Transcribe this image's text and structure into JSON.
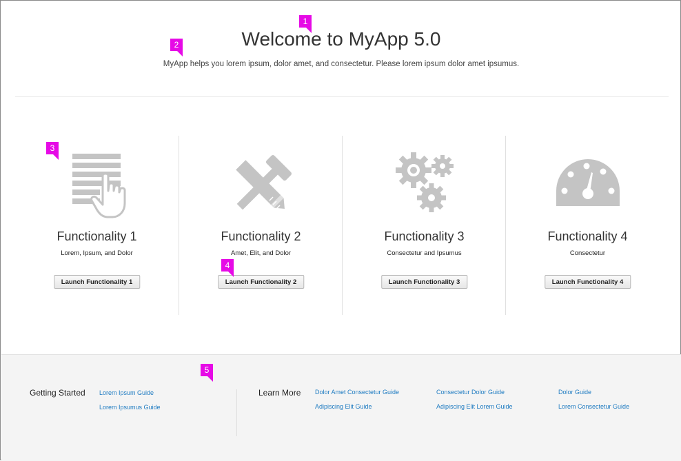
{
  "header": {
    "title_prefix": "Welcome to ",
    "title_app": "MyApp 5.0",
    "subtitle": "MyApp helps you lorem ipsum, dolor amet, and consectetur. Please lorem ipsum dolor amet ipsumus."
  },
  "features": [
    {
      "title": "Functionality 1",
      "desc": "Lorem, Ipsum, and Dolor",
      "button": "Launch Functionality 1",
      "icon": "list-touch-icon"
    },
    {
      "title": "Functionality 2",
      "desc": "Amet, Elit, and Dolor",
      "button": "Launch Functionality 2",
      "icon": "tools-icon"
    },
    {
      "title": "Functionality 3",
      "desc": "Consectetur and Ipsumus",
      "button": "Launch Functionality 3",
      "icon": "gears-icon"
    },
    {
      "title": "Functionality 4",
      "desc": "Consectetur",
      "button": "Launch Functionality 4",
      "icon": "gauge-icon"
    }
  ],
  "footer": {
    "getting_started": {
      "heading": "Getting Started",
      "links": [
        "Lorem Ipsum Guide",
        "Lorem Ipsumus Guide"
      ]
    },
    "learn_more": {
      "heading": "Learn More",
      "links": [
        "Dolor Amet Consectetur Guide",
        "Adipiscing Elit Guide",
        "Consectetur Dolor Guide",
        "Adipiscing Elit Lorem Guide",
        "Dolor Guide",
        "Lorem Consectetur Guide"
      ]
    }
  },
  "annotations": [
    "1",
    "2",
    "3",
    "4",
    "5"
  ],
  "colors": {
    "link": "#1e7bc1",
    "icon": "#c4c4c4",
    "marker": "#e60ae6",
    "footer_bg": "#f4f4f4"
  }
}
